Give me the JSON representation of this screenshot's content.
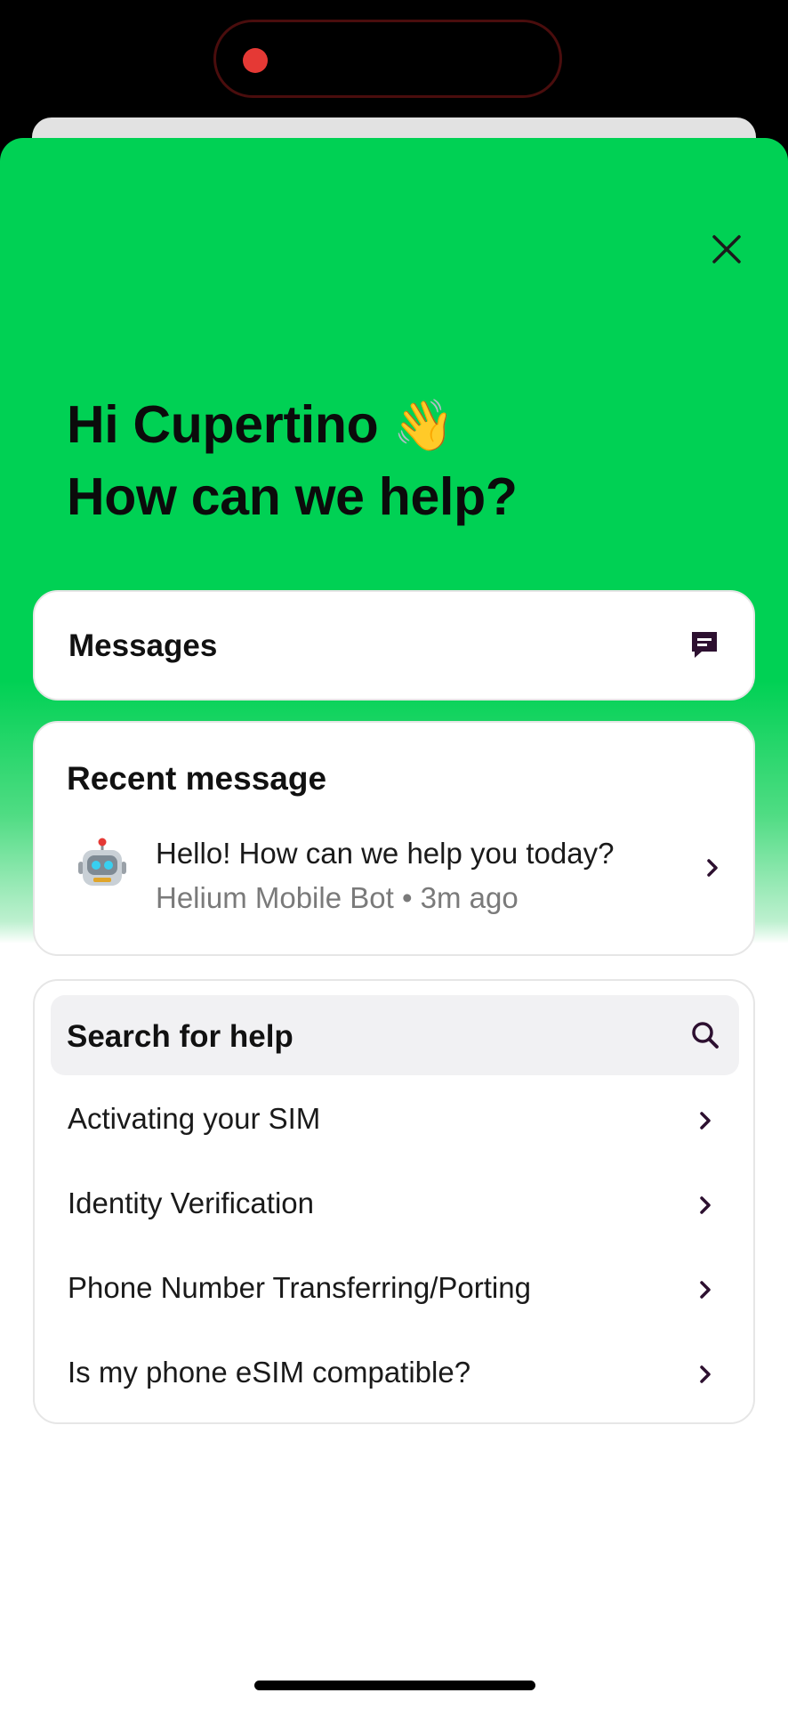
{
  "header": {
    "greeting_line1": "Hi Cupertino",
    "greeting_emoji": "👋",
    "greeting_line2": "How can we help?"
  },
  "messages": {
    "label": "Messages",
    "icon": "message-icon"
  },
  "recent": {
    "title": "Recent message",
    "avatar": "🤖",
    "text": "Hello! How can we help you today?",
    "meta": "Helium Mobile Bot • 3m ago"
  },
  "help": {
    "search_label": "Search for help",
    "items": [
      {
        "label": "Activating your SIM"
      },
      {
        "label": "Identity Verification"
      },
      {
        "label": "Phone Number Transferring/Porting"
      },
      {
        "label": "Is my phone eSIM compatible?"
      }
    ]
  },
  "colors": {
    "brand_green": "#00d154",
    "icon_purple": "#2d1030"
  }
}
